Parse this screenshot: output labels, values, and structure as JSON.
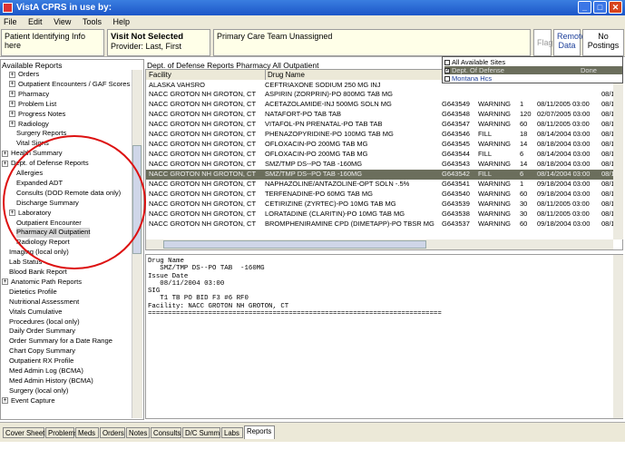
{
  "window": {
    "title": "VistA CPRS in use by:",
    "min": "_",
    "max": "□",
    "close": "✕"
  },
  "menu": [
    "File",
    "Edit",
    "View",
    "Tools",
    "Help"
  ],
  "patient": {
    "info": "Patient Identifying Info here",
    "visit_title": "Visit Not Selected",
    "provider": "Provider: Last, First",
    "pc_team": "Primary Care Team Unassigned",
    "flag": "Flag",
    "remote_line1": "Remote",
    "remote_line2": "Data",
    "postings": "No Postings"
  },
  "left": {
    "label": "Available Reports",
    "tree": [
      {
        "t": "Orders",
        "d": 1,
        "e": true
      },
      {
        "t": "Outpatient Encounters / GAF Scores",
        "d": 1,
        "e": true
      },
      {
        "t": "Pharmacy",
        "d": 1,
        "e": true
      },
      {
        "t": "Problem List",
        "d": 1,
        "e": true
      },
      {
        "t": "Progress Notes",
        "d": 1,
        "e": true
      },
      {
        "t": "Radiology",
        "d": 1,
        "e": true
      },
      {
        "t": "Surgery Reports",
        "d": 2,
        "e": false
      },
      {
        "t": "Vital Signs",
        "d": 2,
        "e": false
      },
      {
        "t": "Health Summary",
        "d": 0,
        "e": true
      },
      {
        "t": "Dept. of Defense Reports",
        "d": 0,
        "e": true
      },
      {
        "t": "Allergies",
        "d": 2,
        "e": false
      },
      {
        "t": "Expanded ADT",
        "d": 2,
        "e": false
      },
      {
        "t": "Consults (DOD Remote data only)",
        "d": 2,
        "e": false
      },
      {
        "t": "Discharge Summary",
        "d": 2,
        "e": false
      },
      {
        "t": "Laboratory",
        "d": 1,
        "e": true
      },
      {
        "t": "Outpatient Encounter",
        "d": 2,
        "e": false
      },
      {
        "t": "Pharmacy All Outpatient",
        "d": 2,
        "e": false
      },
      {
        "t": "Radiology Report",
        "d": 2,
        "e": false
      },
      {
        "t": "Imaging (local only)",
        "d": 1,
        "e": false
      },
      {
        "t": "Lab Status",
        "d": 1,
        "e": false
      },
      {
        "t": "Blood Bank Report",
        "d": 1,
        "e": false
      },
      {
        "t": "Anatomic Path Reports",
        "d": 0,
        "e": true
      },
      {
        "t": "Dietetics Profile",
        "d": 1,
        "e": false
      },
      {
        "t": "Nutritional Assessment",
        "d": 1,
        "e": false
      },
      {
        "t": "Vitals Cumulative",
        "d": 1,
        "e": false
      },
      {
        "t": "Procedures (local only)",
        "d": 1,
        "e": false
      },
      {
        "t": "Daily Order Summary",
        "d": 1,
        "e": false
      },
      {
        "t": "Order Summary for a Date Range",
        "d": 1,
        "e": false
      },
      {
        "t": "Chart Copy Summary",
        "d": 1,
        "e": false
      },
      {
        "t": "Outpatient RX Profile",
        "d": 1,
        "e": false
      },
      {
        "t": "Med Admin Log (BCMA)",
        "d": 1,
        "e": false
      },
      {
        "t": "Med Admin History (BCMA)",
        "d": 1,
        "e": false
      },
      {
        "t": "Surgery (local only)",
        "d": 1,
        "e": false
      },
      {
        "t": "Event Capture",
        "d": 0,
        "e": true
      }
    ]
  },
  "table": {
    "label": "Dept. of Defense Reports Pharmacy All Outpatient",
    "headers": [
      "Facility",
      "Drug Name"
    ],
    "rows": [
      [
        "ALASKA VAHSRO",
        "CEFTRIAXONE SODIUM 250 MG INJ",
        "",
        "",
        "",
        "",
        ""
      ],
      [
        "NACC GROTON NH GROTON, CT",
        "ASPIRIN (ZORPRIN)-PO 800MG TAB MG",
        "",
        "",
        "",
        "",
        "08/11"
      ],
      [
        "NACC GROTON NH GROTON, CT",
        "ACETAZOLAMIDE-INJ 500MG SOLN MG",
        "G643549",
        "WARNING",
        "1",
        "08/11/2005 03:00",
        "08/11"
      ],
      [
        "NACC GROTON NH GROTON, CT",
        "NATAFORT-PO TAB TAB",
        "G643548",
        "WARNING",
        "120",
        "02/07/2005 03:00",
        "08/11"
      ],
      [
        "NACC GROTON NH GROTON, CT",
        "VITAFOL-PN PRENATAL-PO TAB TAB",
        "G643547",
        "WARNING",
        "60",
        "08/11/2005 03:00",
        "08/11"
      ],
      [
        "NACC GROTON NH GROTON, CT",
        "PHENAZOPYRIDINE-PO 100MG TAB MG",
        "G643546",
        "FILL",
        "18",
        "08/14/2004 03:00",
        "08/11"
      ],
      [
        "NACC GROTON NH GROTON, CT",
        "OFLOXACIN-PO 200MG TAB MG",
        "G643545",
        "WARNING",
        "14",
        "08/18/2004 03:00",
        "08/11"
      ],
      [
        "NACC GROTON NH GROTON, CT",
        "OFLOXACIN-PO 200MG TAB MG",
        "G643544",
        "FILL",
        "6",
        "08/14/2004 03:00",
        "08/11"
      ],
      [
        "NACC GROTON NH GROTON, CT",
        "SMZ/TMP DS--PO TAB -160MG",
        "G643543",
        "WARNING",
        "14",
        "08/18/2004 03:00",
        "08/11"
      ],
      [
        "NACC GROTON NH GROTON, CT",
        "SMZ/TMP DS--PO TAB -160MG",
        "G643542",
        "FILL",
        "6",
        "08/14/2004 03:00",
        "08/11"
      ],
      [
        "NACC GROTON NH GROTON, CT",
        "NAPHAZOLINE/ANTAZOLINE-OPT SOLN -.5%",
        "G643541",
        "WARNING",
        "1",
        "09/18/2004 03:00",
        "08/11"
      ],
      [
        "NACC GROTON NH GROTON, CT",
        "TERFENADINE-PO 60MG TAB MG",
        "G643540",
        "WARNING",
        "60",
        "09/18/2004 03:00",
        "08/11"
      ],
      [
        "NACC GROTON NH GROTON, CT",
        "CETIRIZINE (ZYRTEC)-PO 10MG TAB MG",
        "G643539",
        "WARNING",
        "30",
        "08/11/2005 03:00",
        "08/11"
      ],
      [
        "NACC GROTON NH GROTON, CT",
        "LORATADINE (CLARITIN)-PO 10MG TAB MG",
        "G643538",
        "WARNING",
        "30",
        "08/11/2005 03:00",
        "08/11"
      ],
      [
        "NACC GROTON NH GROTON, CT",
        "BROMPHENIRAMINE CPD (DIMETAPP)-PO TBSR MG",
        "G643537",
        "WARNING",
        "60",
        "09/18/2004 03:00",
        "08/11"
      ]
    ],
    "selected_row": 9
  },
  "sites": {
    "items": [
      "All Available Sites",
      "Dept. Of Defense",
      "Montana Hcs"
    ],
    "checked": [
      false,
      true,
      false
    ],
    "done": "Done"
  },
  "detail": "Drug Name\n   SMZ/TMP DS--PO TAB  -160MG\nIssue Date\n   08/11/2004 03:00\nSIG\n   T1 TB PO BID F3 #6 RF0\nFacility: NACC GROTON NH GROTON, CT\n=========================================================================",
  "tabs": [
    "Cover Sheet",
    "Problems",
    "Meds",
    "Orders",
    "Notes",
    "Consults",
    "D/C Summ",
    "Labs",
    "Reports"
  ],
  "active_tab": "Reports"
}
